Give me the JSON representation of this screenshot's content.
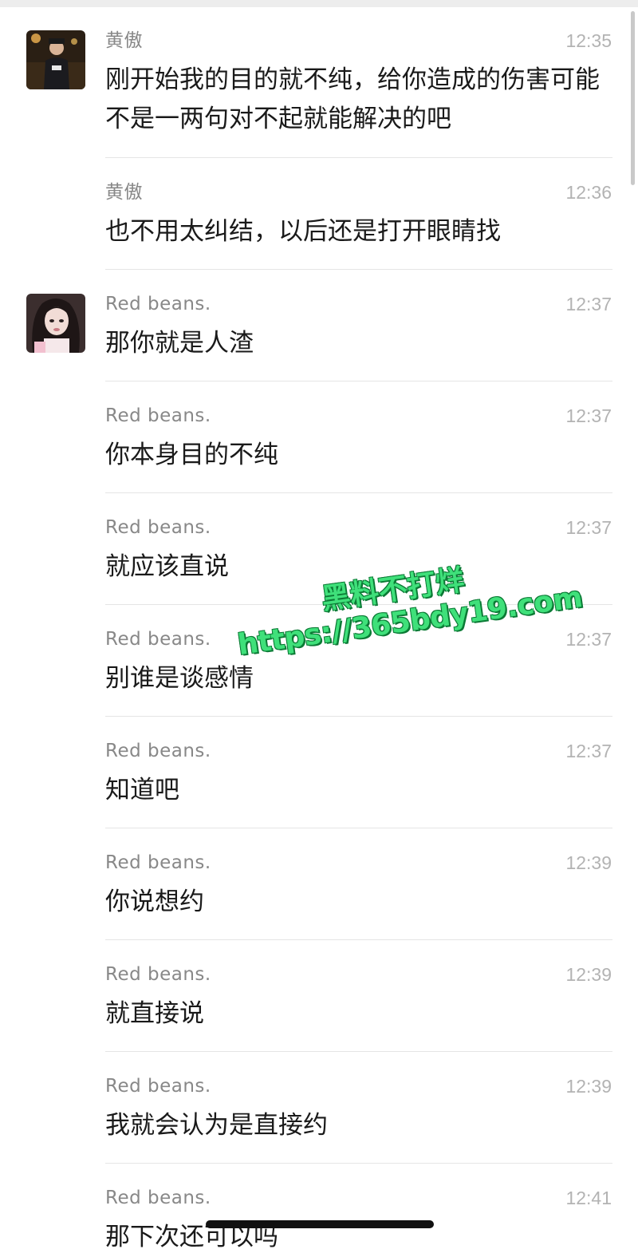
{
  "messages": [
    {
      "sender": "黄傲",
      "time": "12:35",
      "text": "刚开始我的目的就不纯，给你造成的伤害可能不是一两句对不起就能解决的吧",
      "avatar": "huangao"
    },
    {
      "sender": "黄傲",
      "time": "12:36",
      "text": "也不用太纠结，以后还是打开眼睛找",
      "avatar": ""
    },
    {
      "sender": "Red  beans.",
      "time": "12:37",
      "text": "那你就是人渣",
      "avatar": "redbeans"
    },
    {
      "sender": "Red  beans.",
      "time": "12:37",
      "text": "你本身目的不纯",
      "avatar": ""
    },
    {
      "sender": "Red  beans.",
      "time": "12:37",
      "text": "就应该直说",
      "avatar": ""
    },
    {
      "sender": "Red  beans.",
      "time": "12:37",
      "text": "别谁是谈感情",
      "avatar": ""
    },
    {
      "sender": "Red  beans.",
      "time": "12:37",
      "text": "知道吧",
      "avatar": ""
    },
    {
      "sender": "Red  beans.",
      "time": "12:39",
      "text": "你说想约",
      "avatar": ""
    },
    {
      "sender": "Red  beans.",
      "time": "12:39",
      "text": "就直接说",
      "avatar": ""
    },
    {
      "sender": "Red  beans.",
      "time": "12:39",
      "text": "我就会认为是直接约",
      "avatar": ""
    },
    {
      "sender": "Red  beans.",
      "time": "12:41",
      "text": "那下次还可以吗",
      "avatar": ""
    }
  ],
  "watermark": {
    "title": "黑料不打烊",
    "url": "https://365bdy19.com"
  }
}
